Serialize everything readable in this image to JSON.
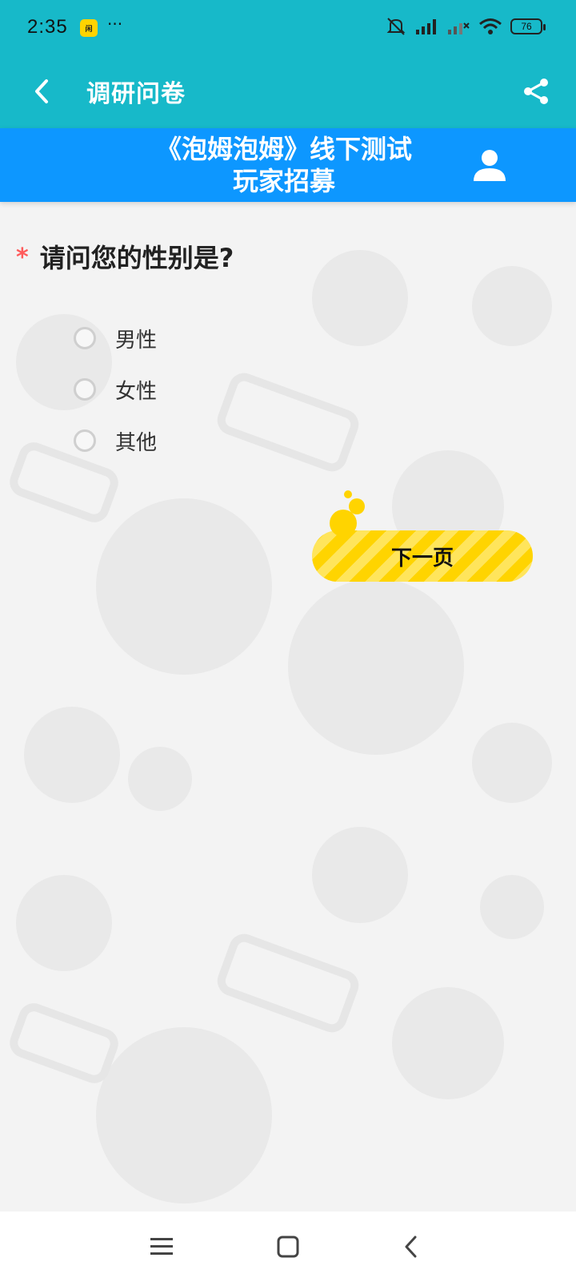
{
  "status_bar": {
    "time": "2:35",
    "app_badge": "闲鱼",
    "more": "···",
    "battery": "76"
  },
  "app_bar": {
    "title": "调研问卷",
    "back_icon": "chevron-left-icon",
    "share_icon": "share-icon",
    "bg_color": "#17b9c9"
  },
  "banner": {
    "title": "《泡姆泡姆》线下测试\n玩家招募",
    "title_line1": "《泡姆泡姆》线下测试",
    "title_line2": "玩家招募",
    "user_icon": "user-icon",
    "bg_color": "#0d97ff"
  },
  "question": {
    "required_mark": "*",
    "text": "请问您的性别是?",
    "options": [
      {
        "label": "男性"
      },
      {
        "label": "女性"
      },
      {
        "label": "其他"
      }
    ]
  },
  "next_button": {
    "label": "下一页",
    "color": "#ffd400"
  },
  "nav_bar": {
    "menu_icon": "menu-icon",
    "home_icon": "square-home-icon",
    "back_icon": "back-triangle-icon"
  }
}
